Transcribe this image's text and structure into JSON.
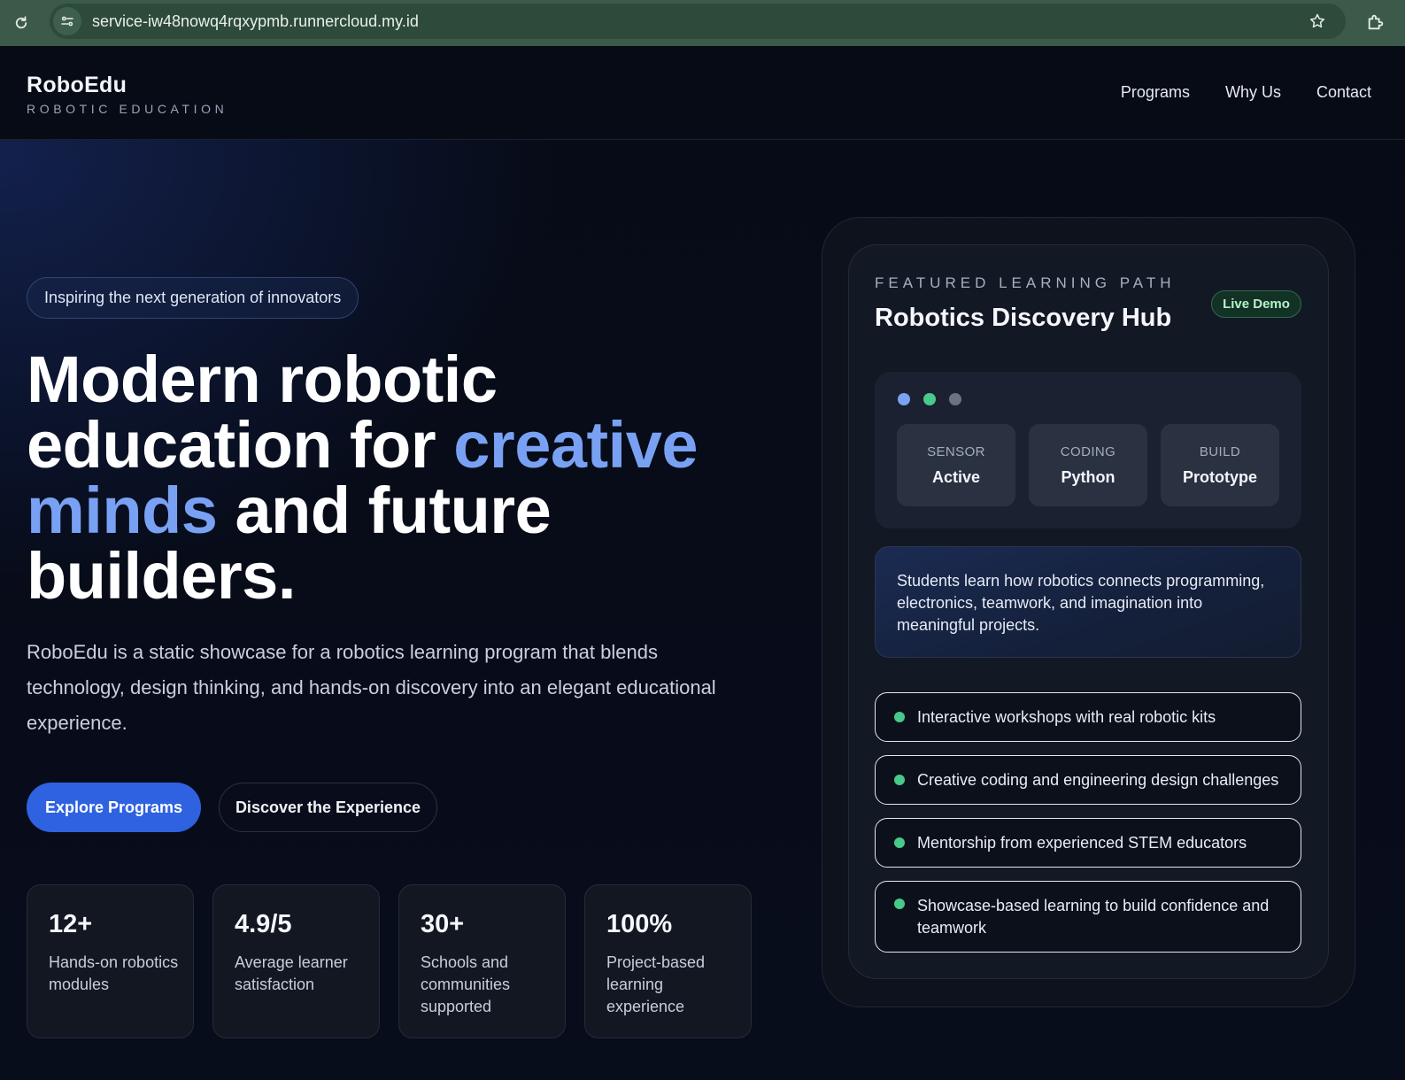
{
  "browser": {
    "url": "service-iw48nowq4rqxypmb.runnercloud.my.id",
    "icons": [
      "reload-icon",
      "site-info-icon",
      "star-icon",
      "extensions-icon"
    ]
  },
  "header": {
    "brand_name": "RoboEdu",
    "brand_tagline": "ROBOTIC EDUCATION",
    "nav": [
      {
        "label": "Programs"
      },
      {
        "label": "Why Us"
      },
      {
        "label": "Contact"
      }
    ]
  },
  "hero": {
    "pill": "Inspiring the next generation of innovators",
    "title_part1": "Modern robotic education for ",
    "title_accent": "creative minds",
    "title_part2": " and future builders.",
    "description": "RoboEdu is a static showcase for a robotics learning program that blends technology, design thinking, and hands-on discovery into an elegant educational experience.",
    "primary_button": "Explore Programs",
    "secondary_button": "Discover the Experience",
    "stats": [
      {
        "value": "12+",
        "label": "Hands-on robotics modules"
      },
      {
        "value": "4.9/5",
        "label": "Average learner satisfaction"
      },
      {
        "value": "30+",
        "label": "Schools and communities supported"
      },
      {
        "value": "100%",
        "label": "Project-based learning experience"
      }
    ]
  },
  "panel": {
    "eyebrow": "FEATURED LEARNING PATH",
    "title": "Robotics Discovery Hub",
    "badge": "Live Demo",
    "dots_colors": [
      "#7aa2f5",
      "#49c98b",
      "#6b7282"
    ],
    "tiles": [
      {
        "label": "SENSOR",
        "value": "Active"
      },
      {
        "label": "CODING",
        "value": "Python"
      },
      {
        "label": "BUILD",
        "value": "Prototype"
      }
    ],
    "info": "Students learn how robotics connects programming, electronics, teamwork, and imagination into meaningful projects.",
    "features": [
      "Interactive workshops with real robotic kits",
      "Creative coding and engineering design challenges",
      "Mentorship from experienced STEM educators",
      "Showcase-based learning to build confidence and teamwork"
    ]
  },
  "colors": {
    "accent": "#79a1f3",
    "primary_button": "#2f62e0",
    "success": "#47c98a",
    "background": "#070b16"
  }
}
